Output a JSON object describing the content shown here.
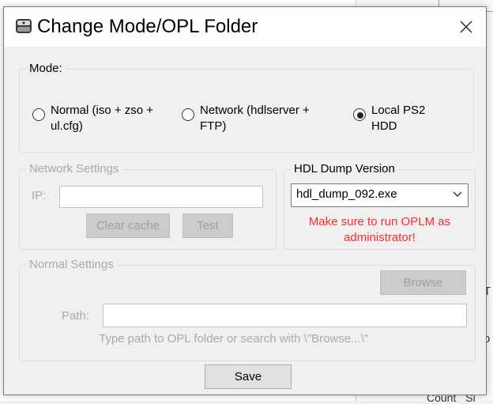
{
  "dialog": {
    "title": "Change Mode/OPL Folder",
    "close_glyph": "✕"
  },
  "mode": {
    "legend": "Mode:",
    "options": [
      {
        "label_line1": "Normal (iso + zso +",
        "label_line2": "ul.cfg)",
        "selected": false
      },
      {
        "label_line1": "Network (hdlserver +",
        "label_line2": "FTP)",
        "selected": false
      },
      {
        "label_line1": "Local PS2",
        "label_line2": "HDD",
        "selected": true
      }
    ]
  },
  "network": {
    "legend": "Network Settings",
    "ip_label": "IP:",
    "ip_value": "",
    "clear_cache_label": "Clear cache",
    "test_label": "Test"
  },
  "hdl": {
    "legend": "HDL Dump Version",
    "selected": "hdl_dump_092.exe",
    "warning_line1": "Make sure to run OPLM as",
    "warning_line2": "administrator!"
  },
  "normal": {
    "legend": "Normal Settings",
    "browse_label": "Browse",
    "path_label": "Path:",
    "path_value": "",
    "hint": "Type path to OPL folder or search with \\\"Browse...\\\""
  },
  "save_label": "Save",
  "background": {
    "footer_col1": "Count",
    "footer_col2": "Si",
    "edge_chars": [
      "T",
      "o"
    ]
  },
  "colors": {
    "warning": "#ff2a2a",
    "disabled_text": "#a9a9a9"
  }
}
